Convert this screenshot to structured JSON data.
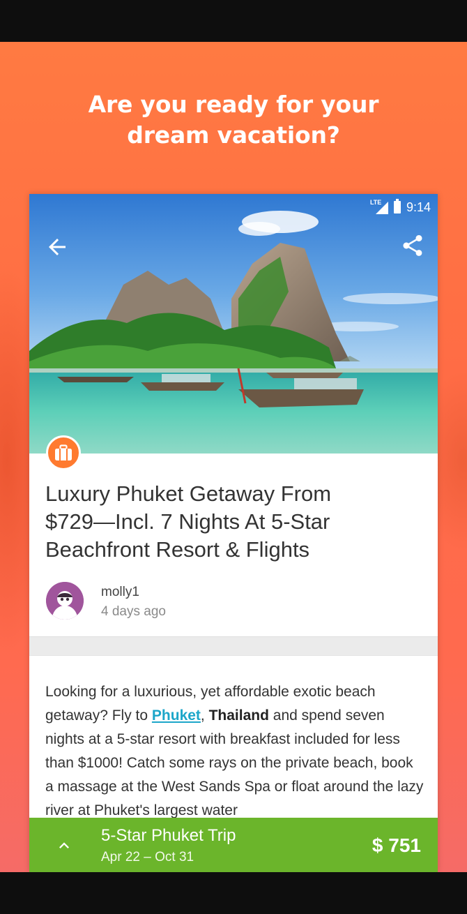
{
  "promo": {
    "headline_line1": "Are you ready for your",
    "headline_line2": "dream vacation?"
  },
  "status_bar": {
    "network": "LTE",
    "time": "9:14"
  },
  "hero": {
    "back_icon": "arrow-left-icon",
    "share_icon": "share-icon",
    "category_icon": "suitcase-icon",
    "category_color": "#ff7a2f"
  },
  "deal": {
    "title_line1": "Luxury Phuket Getaway From",
    "title_line2": "$729—Incl. 7 Nights At 5-Star",
    "title_line3": "Beachfront Resort & Flights"
  },
  "author": {
    "name": "molly1",
    "posted": "4 days ago"
  },
  "description": {
    "p1": "Looking for a luxurious, yet affordable exotic beach getaway? Fly to ",
    "link": "Phuket",
    "p2": ", ",
    "bold": "Thailand",
    "p3": " and spend seven nights at a 5-star resort with breakfast included for less than $1000! Catch some rays on the private beach, book a massage at the West Sands Spa or float around the lazy river at Phuket's largest water"
  },
  "cta": {
    "title": "5-Star Phuket Trip",
    "dates": "Apr 22 – Oct 31",
    "price": "$ 751",
    "expand_icon": "chevron-up-icon",
    "color": "#6bb52b"
  }
}
